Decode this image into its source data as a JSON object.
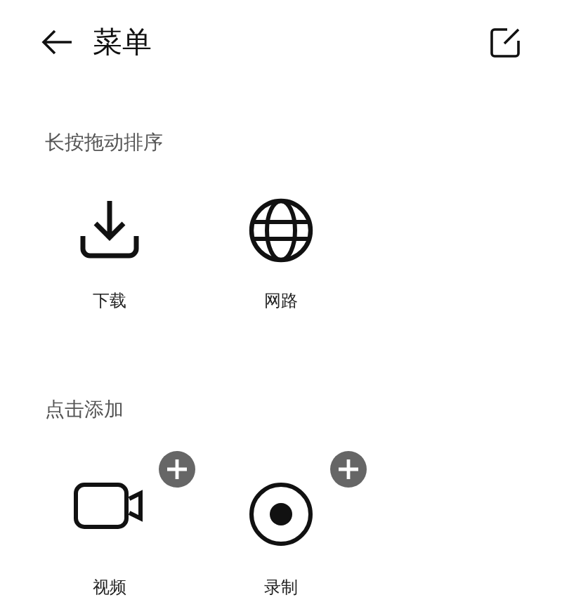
{
  "header": {
    "title": "菜单"
  },
  "sections": [
    {
      "label": "长按拖动排序",
      "kind": "sorted",
      "items": [
        {
          "label": "下载",
          "kind": "download"
        },
        {
          "label": "网路",
          "kind": "globe"
        }
      ]
    },
    {
      "label": "点击添加",
      "kind": "addable",
      "items": [
        {
          "label": "视频",
          "kind": "video"
        },
        {
          "label": "录制",
          "kind": "record"
        }
      ]
    }
  ]
}
